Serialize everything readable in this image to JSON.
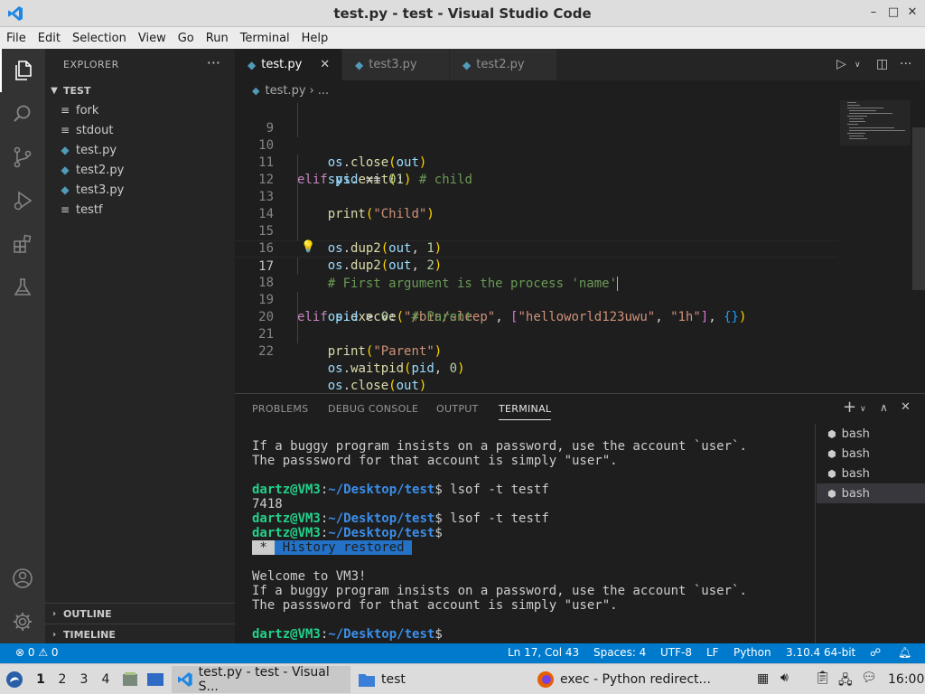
{
  "window": {
    "title": "test.py - test - Visual Studio Code",
    "controls": [
      "–",
      "□",
      "✕"
    ]
  },
  "menu": [
    "File",
    "Edit",
    "Selection",
    "View",
    "Go",
    "Run",
    "Terminal",
    "Help"
  ],
  "activity_bar": [
    "explorer",
    "search",
    "source-control",
    "run-and-debug",
    "extensions",
    "testing",
    "accounts",
    "manage"
  ],
  "sidebar": {
    "header": "EXPLORER",
    "more": "···",
    "folder": "TEST",
    "files": [
      {
        "name": "fork",
        "type": "text"
      },
      {
        "name": "stdout",
        "type": "text"
      },
      {
        "name": "test.py",
        "type": "python"
      },
      {
        "name": "test2.py",
        "type": "python"
      },
      {
        "name": "test3.py",
        "type": "python"
      },
      {
        "name": "testf",
        "type": "text"
      }
    ],
    "outline": "OUTLINE",
    "timeline": "TIMELINE"
  },
  "tabs": [
    {
      "label": "test.py",
      "active": true
    },
    {
      "label": "test3.py",
      "active": false
    },
    {
      "label": "test2.py",
      "active": false
    }
  ],
  "breadcrumb": {
    "file": "test.py",
    "rest": "..."
  },
  "editor": {
    "line_numbers": [
      "9",
      "10",
      "11",
      "12",
      "13",
      "14",
      "15",
      "16",
      "17",
      "18",
      "19",
      "20",
      "21",
      "22"
    ],
    "current_line": "17"
  },
  "panel": {
    "tabs": [
      "PROBLEMS",
      "DEBUG CONSOLE",
      "OUTPUT",
      "TERMINAL"
    ],
    "active_tab": "TERMINAL",
    "terminal": {
      "l1": "If a buggy program insists on a password, use the account `user`.",
      "l2": "The passsword for that account is simply \"user\".",
      "prompt_user": "dartz@VM3",
      "prompt_sep": ":",
      "prompt_path": "~/Desktop/test",
      "prompt_end": "$ ",
      "cmd1": "lsof -t testf",
      "out1": "7418",
      "cmd2": "lsof -t testf",
      "hist_star": " * ",
      "hist_text": " History restored ",
      "welcome": "Welcome to VM3!",
      "l3": "If a buggy program insists on a password, use the account `user`.",
      "l4": "The passsword for that account is simply \"user\"."
    },
    "terminals": [
      "bash",
      "bash",
      "bash",
      "bash"
    ]
  },
  "statusbar": {
    "problems": "⊗ 0 ⚠ 0",
    "position": "Ln 17, Col 43",
    "spaces": "Spaces: 4",
    "encoding": "UTF-8",
    "eol": "LF",
    "language": "Python",
    "interpreter": "3.10.4 64-bit"
  },
  "taskbar": {
    "workspaces": [
      "1",
      "2",
      "3",
      "4"
    ],
    "windows": [
      "test.py - test - Visual S...",
      "test",
      "exec - Python redirect..."
    ],
    "clock": "16:00"
  },
  "colors": {
    "accent": "#007acc",
    "sidebar": "#252526",
    "editor": "#1e1e1e",
    "activity": "#333333"
  }
}
